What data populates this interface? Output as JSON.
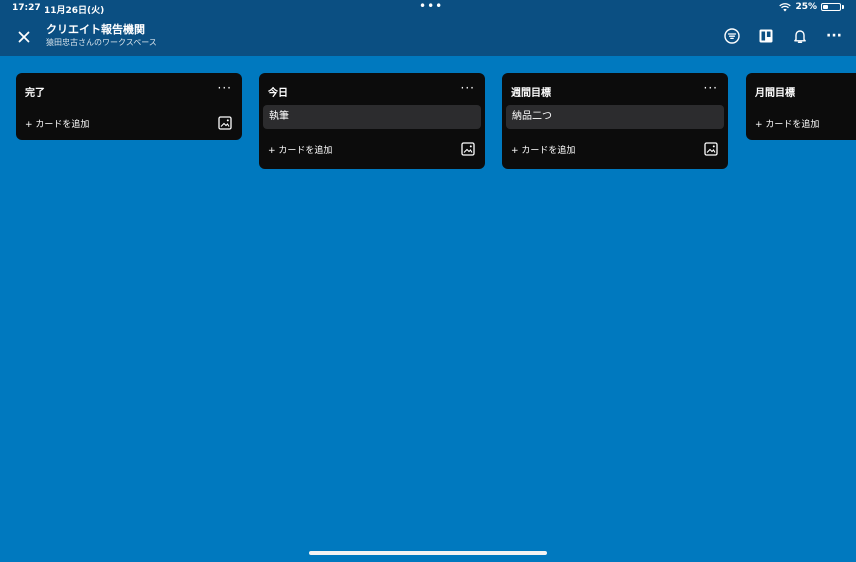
{
  "status_bar": {
    "time": "17:27",
    "date": "11月26日(火)",
    "dots": "•••",
    "battery": "25%"
  },
  "header": {
    "board_title": "クリエイト報告機関",
    "workspace": "猿田忠古さんのワークスペース",
    "icons": [
      "close-icon",
      "filter-icon",
      "board-view-icon",
      "bell-icon",
      "more-icon"
    ]
  },
  "lists": [
    {
      "title": "完了",
      "menu": "···",
      "cards": [],
      "add_label": "+ カードを追加"
    },
    {
      "title": "今日",
      "menu": "···",
      "cards": [
        {
          "title": "執筆"
        }
      ],
      "add_label": "+ カードを追加"
    },
    {
      "title": "週間目標",
      "menu": "···",
      "cards": [
        {
          "title": "納品二つ"
        }
      ],
      "add_label": "+ カードを追加"
    },
    {
      "title": "月間目標",
      "menu": "···",
      "cards": [],
      "add_label": "+ カードを追加"
    }
  ],
  "colors": {
    "board_background": "#0079bf",
    "top_bar": "#0b4f82",
    "list_background": "#0c0c0c",
    "card_background": "#2c2c2e"
  }
}
